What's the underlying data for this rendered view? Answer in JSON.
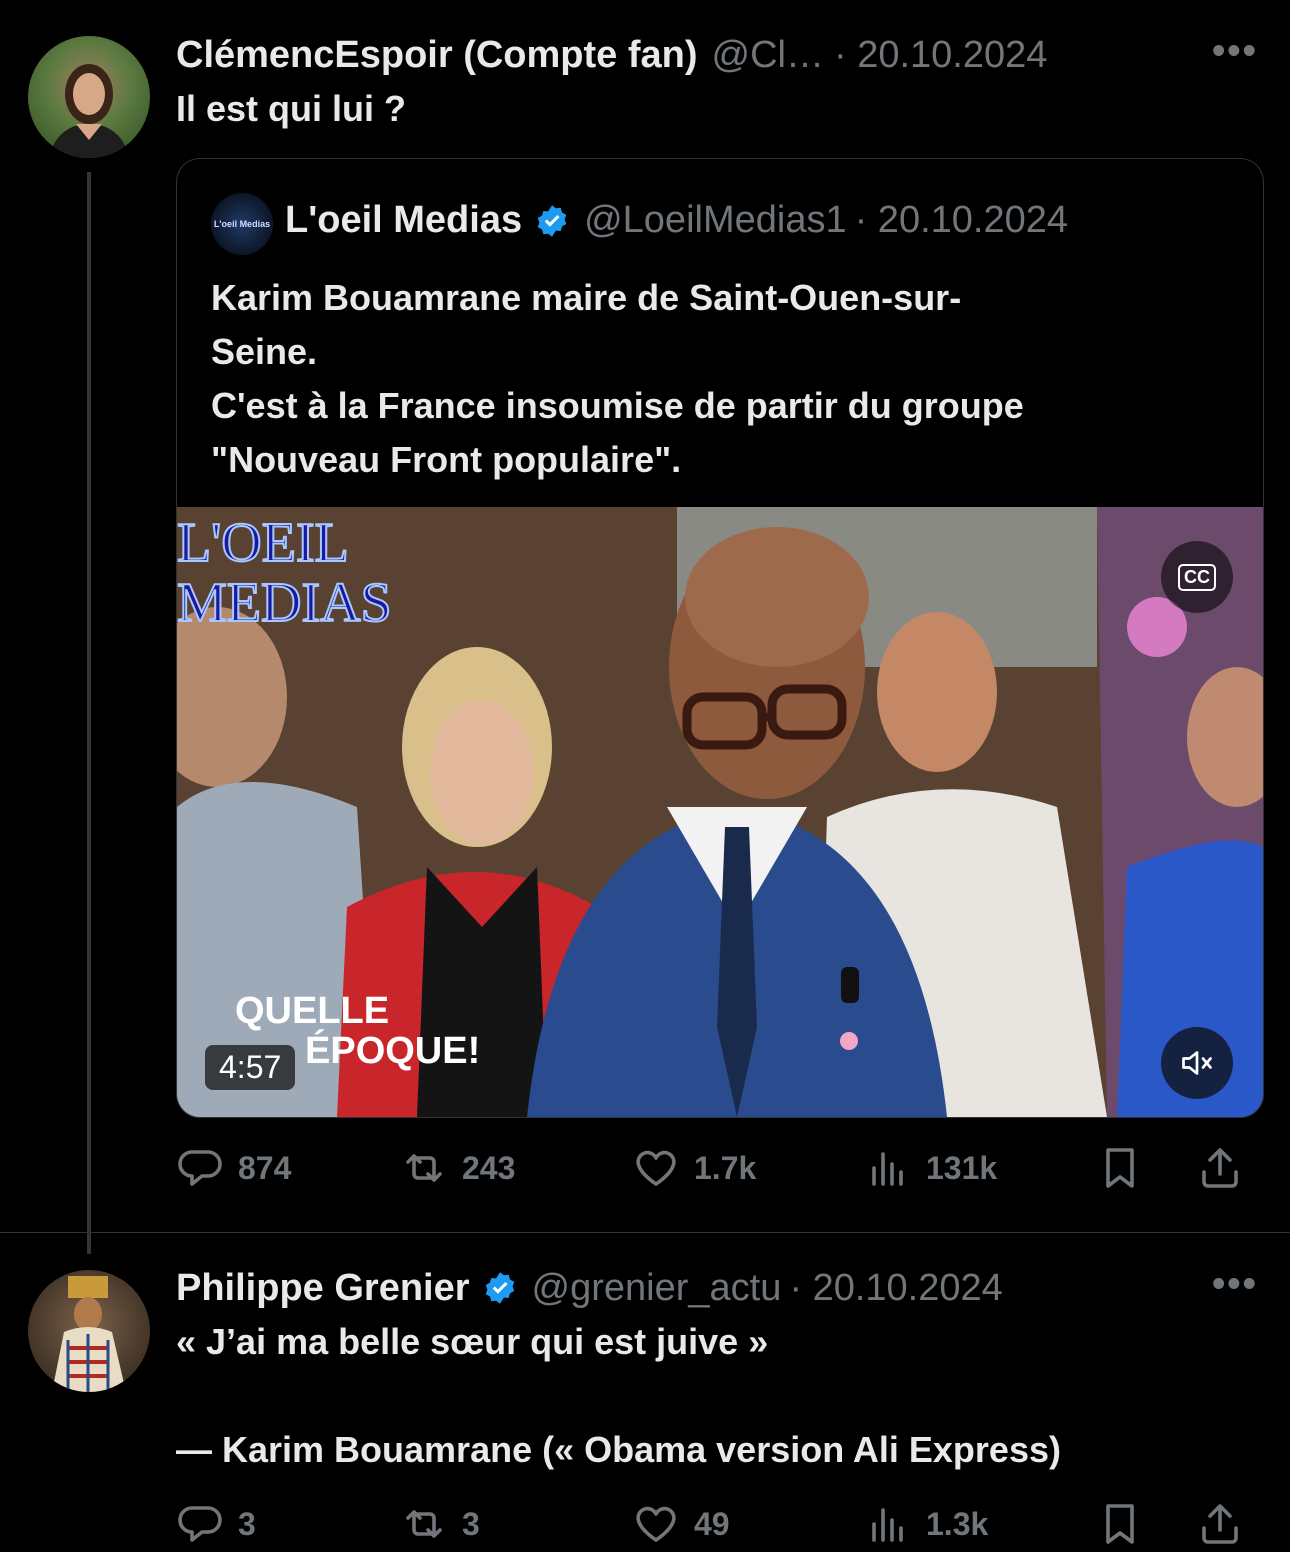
{
  "tweet1": {
    "author_name": "ClémencEspoir (Compte fan)",
    "author_handle": "@Cl…",
    "date": "· 20.10.2024",
    "text": "Il est qui lui ?",
    "more_icon": "more-dots-icon"
  },
  "quote": {
    "author_name": "L'oeil Medias",
    "author_handle": "@LoeilMedias1",
    "date": "· 20.10.2024",
    "avatar_text": "L'oeil Medias",
    "text_line1": "Karim Bouamrane maire de Saint-Ouen-sur-",
    "text_line2": "Seine.",
    "text_line3": "C'est à la France insoumise de partir du groupe",
    "text_line4": "\"Nouveau Front populaire\".",
    "video": {
      "watermark_line1": "L'OEIL",
      "watermark_line2": "MEDIAS",
      "show_logo_line1": "QUELLE",
      "show_logo_line2": "ÉPOQUE!",
      "duration": "4:57",
      "cc_label": "CC"
    }
  },
  "tweet1_actions": {
    "replies": "874",
    "reposts": "243",
    "likes": "1.7k",
    "views": "131k"
  },
  "tweet2": {
    "author_name": "Philippe Grenier",
    "author_handle": "@grenier_actu",
    "date": "· 20.10.2024",
    "text_line1": "« J’ai ma belle sœur qui est juive »",
    "text_line2": "— Karim Bouamrane (« Obama version Ali Express)"
  },
  "tweet2_actions": {
    "replies": "3",
    "reposts": "3",
    "likes": "49",
    "views": "1.3k"
  },
  "colors": {
    "background": "#000000",
    "text": "#e7e9ea",
    "muted": "#71767b",
    "verified": "#1d9bf0"
  }
}
